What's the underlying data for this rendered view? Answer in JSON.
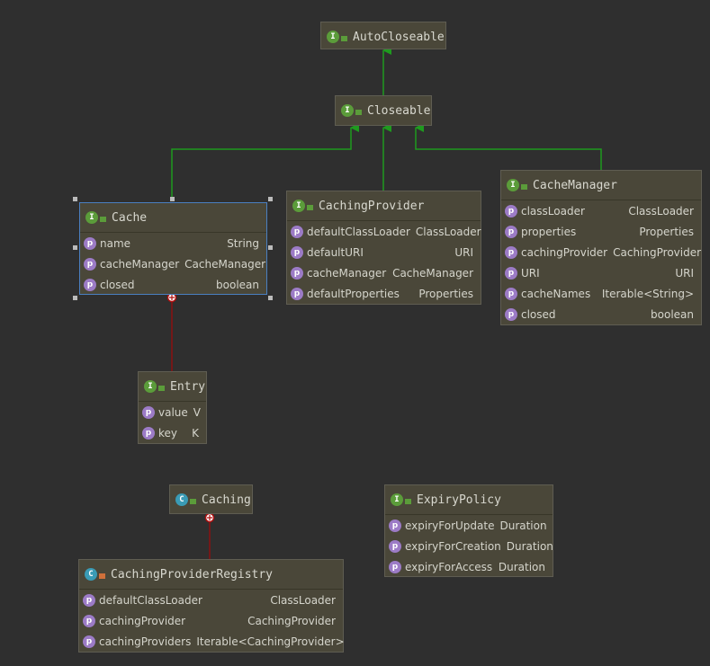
{
  "classes": {
    "autocloseable": {
      "name": "AutoCloseable",
      "kind": "I"
    },
    "closeable": {
      "name": "Closeable",
      "kind": "I"
    },
    "cache": {
      "name": "Cache",
      "kind": "I",
      "fields": [
        {
          "n": "name",
          "t": "String"
        },
        {
          "n": "cacheManager",
          "t": "CacheManager"
        },
        {
          "n": "closed",
          "t": "boolean"
        }
      ]
    },
    "cachingprovider": {
      "name": "CachingProvider",
      "kind": "I",
      "fields": [
        {
          "n": "defaultClassLoader",
          "t": "ClassLoader"
        },
        {
          "n": "defaultURI",
          "t": "URI"
        },
        {
          "n": "cacheManager",
          "t": "CacheManager"
        },
        {
          "n": "defaultProperties",
          "t": "Properties"
        }
      ]
    },
    "cachemanager": {
      "name": "CacheManager",
      "kind": "I",
      "fields": [
        {
          "n": "classLoader",
          "t": "ClassLoader"
        },
        {
          "n": "properties",
          "t": "Properties"
        },
        {
          "n": "cachingProvider",
          "t": "CachingProvider"
        },
        {
          "n": "URI",
          "t": "URI"
        },
        {
          "n": "cacheNames",
          "t": "Iterable<String>"
        },
        {
          "n": "closed",
          "t": "boolean"
        }
      ]
    },
    "entry": {
      "name": "Entry",
      "kind": "I",
      "fields": [
        {
          "n": "value",
          "t": "V"
        },
        {
          "n": "key",
          "t": "K"
        }
      ]
    },
    "caching": {
      "name": "Caching",
      "kind": "C"
    },
    "registry": {
      "name": "CachingProviderRegistry",
      "kind": "C",
      "fields": [
        {
          "n": "defaultClassLoader",
          "t": "ClassLoader"
        },
        {
          "n": "cachingProvider",
          "t": "CachingProvider"
        },
        {
          "n": "cachingProviders",
          "t": "Iterable<CachingProvider>"
        }
      ]
    },
    "expirypolicy": {
      "name": "ExpiryPolicy",
      "kind": "I",
      "fields": [
        {
          "n": "expiryForUpdate",
          "t": "Duration"
        },
        {
          "n": "expiryForCreation",
          "t": "Duration"
        },
        {
          "n": "expiryForAccess",
          "t": "Duration"
        }
      ]
    }
  },
  "field_icon": "p",
  "colors": {
    "inherit": "#1f9a1f",
    "inner": "#8b1010",
    "selection": "#4a7fc0"
  }
}
